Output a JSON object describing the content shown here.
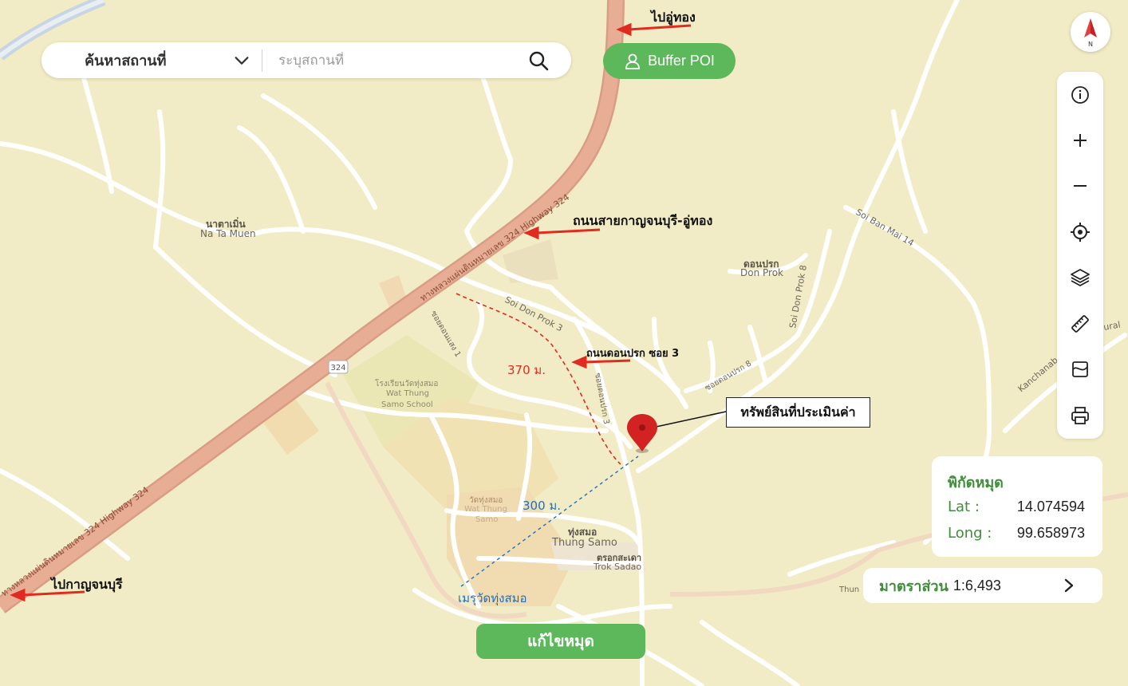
{
  "search": {
    "category_label": "ค้นหาสถานที่",
    "placeholder": "ระบุสถานที่"
  },
  "buffer_button": {
    "label": "Buffer POI"
  },
  "annotations": {
    "to_u_thong": "ไปอู่ทอง",
    "to_kanchanaburi": "ไปกาญจนบุรี",
    "road_kan_uthong": "ถนนสายกาญจนบุรี-อู่ทอง",
    "road_don_prok_3": "ถนนดอนปรก ซอย 3",
    "asset": "ทรัพย์สินที่ประเมินค่า",
    "dist_370": "370 ม.",
    "dist_300": "300 ม.",
    "meru": "เมรุวัดทุ่งสมอ"
  },
  "places": {
    "na_ta_muen_th": "นาตาเมิ่น",
    "na_ta_muen_en": "Na Ta Muen",
    "don_prok_th": "ดอนปรก",
    "don_prok_en": "Don Prok",
    "thung_samo_th": "ทุ่งสมอ",
    "thung_samo_en": "Thung Samo",
    "trok_sadao_th": "ตรอกสะเดา",
    "trok_sadao_en": "Trok Sadao",
    "school_th": "โรงเรียนวัดทุ่งสมอ",
    "school_en1": "Wat Thung",
    "school_en2": "Samo School",
    "wat_th": "วัดทุ่งสมอ",
    "wat_en1": "Wat Thung",
    "wat_en2": "Samo",
    "highway_label": "ทางหลวงแผ่นดินหมายเลข 324 Highway 324",
    "highway_shield": "324",
    "soi_don_prok_3": "Soi Don Prok 3",
    "soi_don_prok_8": "Soi Don Prok 8",
    "soi_ban_mai_14": "Soi Ban Mai 14",
    "kanchanaburi": "Kanchanab",
    "rural": "ural",
    "thun": "Thun",
    "soi_don_prok_th": "ซอยดอนปรก 8",
    "soi_don_prok_3_th": "ซอยดอนปรก 3",
    "soi_don_prok_1_th": "ซอยดอนแสง 1"
  },
  "coordinates": {
    "title": "พิกัดหมุด",
    "lat_label": "Lat :",
    "lat_value": "14.074594",
    "long_label": "Long :",
    "long_value": "99.658973"
  },
  "scale": {
    "label": "มาตราส่วน",
    "value": "1:6,493"
  },
  "edit_button": {
    "label": "แก้ไขหมุด"
  },
  "toolbar_icons": [
    "info-icon",
    "zoom-in-icon",
    "zoom-out-icon",
    "locate-icon",
    "layers-icon",
    "ruler-icon",
    "draw-area-icon",
    "print-icon"
  ],
  "colors": {
    "accent_green": "#5cb85a",
    "highway": "#e0a58c",
    "marker": "#d32222",
    "annotation_red": "#e02b20",
    "distance_blue": "#1f6fbf"
  }
}
